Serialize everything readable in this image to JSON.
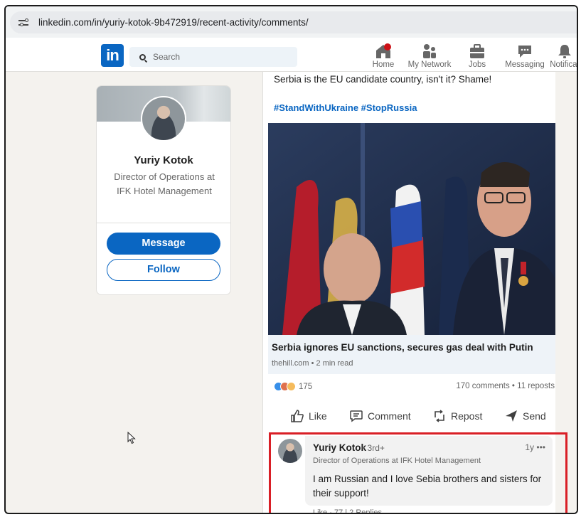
{
  "browser": {
    "url": "linkedin.com/in/yuriy-kotok-9b472919/recent-activity/comments/"
  },
  "nav": {
    "logo": "in",
    "search_placeholder": "Search",
    "items": [
      {
        "label": "Home",
        "icon": "home-icon"
      },
      {
        "label": "My Network",
        "icon": "network-icon"
      },
      {
        "label": "Jobs",
        "icon": "briefcase-icon"
      },
      {
        "label": "Messaging",
        "icon": "messaging-icon"
      },
      {
        "label": "Notificat",
        "icon": "bell-icon"
      }
    ]
  },
  "profile": {
    "name": "Yuriy Kotok",
    "title": "Director of Operations at IFK Hotel Management",
    "message_label": "Message",
    "follow_label": "Follow"
  },
  "post": {
    "text": "Serbia is the EU candidate country, isn't it? Shame!",
    "hashtags": "#StandWithUkraine #StopRussia",
    "article": {
      "title": "Serbia ignores EU sanctions, secures gas deal with Putin",
      "meta": "thehill.com • 2 min read"
    },
    "reactions_count": "175",
    "comments_reposts": "170 comments • 11 reposts",
    "actions": {
      "like": "Like",
      "comment": "Comment",
      "repost": "Repost",
      "send": "Send"
    }
  },
  "comment": {
    "author": "Yuriy Kotok",
    "degree": "• 3rd+",
    "time": "1y",
    "more": "•••",
    "headline": "Director of Operations at IFK Hotel Management",
    "text": "I am Russian and I love Sebia brothers and sisters for their support!",
    "footer": "Like · 77 | 2 Replies"
  },
  "colors": {
    "brand": "#0a66c2",
    "highlight": "#d91f26"
  }
}
